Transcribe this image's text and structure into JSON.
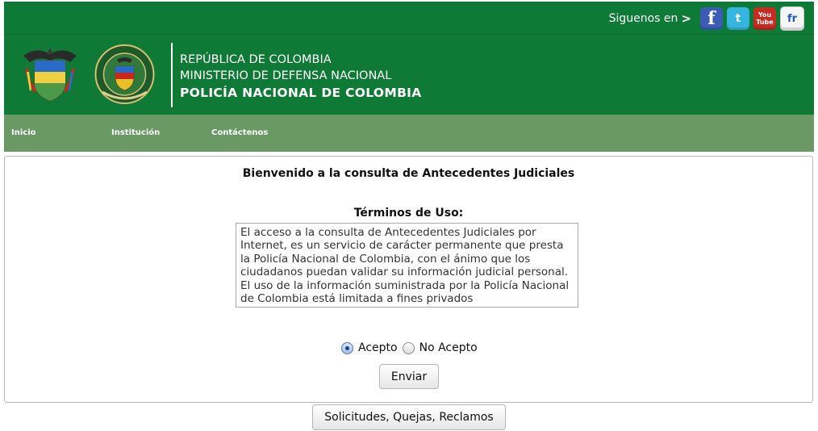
{
  "topbar": {
    "follow_label": "Siguenos en",
    "follow_arrow": ">",
    "social": [
      {
        "name": "facebook",
        "label": "f"
      },
      {
        "name": "twitter",
        "label": "t"
      },
      {
        "name": "youtube",
        "label_top": "You",
        "label_bottom": "Tube"
      },
      {
        "name": "friendfeed",
        "label": "fr"
      }
    ]
  },
  "header": {
    "line1": "REPÚBLICA DE COLOMBIA",
    "line2": "MINISTERIO DE DEFENSA NACIONAL",
    "line3": "POLICÍA NACIONAL DE COLOMBIA"
  },
  "nav": {
    "items": [
      "Inicio",
      "Institución",
      "Contáctenos"
    ]
  },
  "main": {
    "welcome": "Bienvenido a la consulta de Antecedentes Judiciales",
    "terms_title": "Términos de Uso:",
    "terms_text": "El acceso a la consulta de Antecedentes Judiciales por Internet, es un servicio de carácter permanente que presta la Policía Nacional de Colombia, con el ánimo que los ciudadanos puedan validar su información judicial personal. El uso de la información suministrada por la Policía Nacional de Colombia está limitada a fines privados",
    "accept_label": "Acepto",
    "reject_label": "No Acepto",
    "selected": "Acepto",
    "submit_label": "Enviar"
  },
  "footer": {
    "pqr_label": "Solicitudes, Quejas, Reclamos"
  },
  "colors": {
    "header_green": "#0e7a36",
    "nav_green": "#6a9a64"
  }
}
